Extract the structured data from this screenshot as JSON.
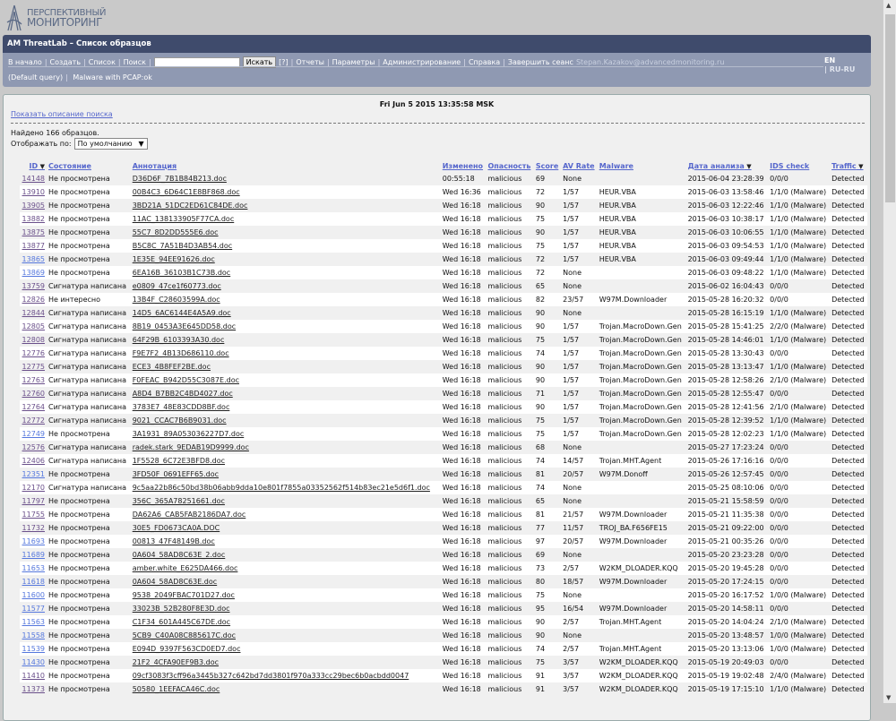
{
  "logo": {
    "line1": "ПЕРСПЕКТИВНЫЙ",
    "line2": "МОНИТОРИНГ"
  },
  "header": {
    "title": "AM ThreatLab – Список образцов"
  },
  "nav": {
    "items": [
      "В начало",
      "Создать",
      "Список",
      "Поиск"
    ],
    "search_value": "",
    "search_button": "Искать",
    "help": "[?]",
    "items2": [
      "Отчеты",
      "Параметры",
      "Администрирование",
      "Справка",
      "Завершить сеанс"
    ],
    "user": "Stepan.Kazakov@advancedmonitoring.ru",
    "queries": [
      "(Default query)",
      "Malware with PCAP:ok"
    ]
  },
  "lang": {
    "en": "EN",
    "ru": "| RU-RU"
  },
  "panel": {
    "datetime": "Fri Jun 5 2015 13:35:58 MSK",
    "show_desc": "Показать описание поиска",
    "found": "Найдено 166 образцов.",
    "display_label": "Отображать по:",
    "display_value": "По умолчанию"
  },
  "table": {
    "headers": [
      "ID",
      "Состояние",
      "Аннотация",
      "Изменено",
      "Опасность",
      "Score",
      "AV Rate",
      "Malware",
      "Дата анализа",
      "IDS check",
      "Traffic"
    ],
    "rows": [
      [
        "14148",
        "Не просмотрена",
        "D36D6F_7B1B84B213.doc",
        "00:55:18",
        "malicious",
        "69",
        "None",
        "",
        "2015-06-04 23:28:39",
        "0/0/0",
        "Detected"
      ],
      [
        "13910",
        "Не просмотрена",
        "00B4C3_6D64C1E8BF868.doc",
        "Wed 16:36",
        "malicious",
        "72",
        "1/57",
        "HEUR.VBA",
        "2015-06-03 13:58:46",
        "1/1/0 (Malware)",
        "Detected"
      ],
      [
        "13905",
        "Не просмотрена",
        "3BD21A_51DC2ED61C84DE.doc",
        "Wed 16:18",
        "malicious",
        "90",
        "1/57",
        "HEUR.VBA",
        "2015-06-03 12:22:46",
        "1/1/0 (Malware)",
        "Detected"
      ],
      [
        "13882",
        "Не просмотрена",
        "11AC_138133905F77CA.doc",
        "Wed 16:18",
        "malicious",
        "75",
        "1/57",
        "HEUR.VBA",
        "2015-06-03 10:38:17",
        "1/1/0 (Malware)",
        "Detected"
      ],
      [
        "13875",
        "Не просмотрена",
        "55C7_8D2DD555E6.doc",
        "Wed 16:18",
        "malicious",
        "90",
        "1/57",
        "HEUR.VBA",
        "2015-06-03 10:06:55",
        "1/1/0 (Malware)",
        "Detected"
      ],
      [
        "13877",
        "Не просмотрена",
        "B5C8C_7A51B4D3AB54.doc",
        "Wed 16:18",
        "malicious",
        "75",
        "1/57",
        "HEUR.VBA",
        "2015-06-03 09:54:53",
        "1/1/0 (Malware)",
        "Detected"
      ],
      [
        "13865",
        "Не просмотрена",
        "1E35E_94EE91626.doc",
        "Wed 16:18",
        "malicious",
        "72",
        "1/57",
        "HEUR.VBA",
        "2015-06-03 09:49:44",
        "1/1/0 (Malware)",
        "Detected"
      ],
      [
        "13869",
        "Не просмотрена",
        "6EA16B_36103B1C73B.doc",
        "Wed 16:18",
        "malicious",
        "72",
        "None",
        "",
        "2015-06-03 09:48:22",
        "1/1/0 (Malware)",
        "Detected"
      ],
      [
        "13759",
        "Сигнатура написана",
        "e0809_47ce1f60773.doc",
        "Wed 16:18",
        "malicious",
        "65",
        "None",
        "",
        "2015-06-02 16:04:43",
        "0/0/0",
        "Detected"
      ],
      [
        "12826",
        "Не интересно",
        "13B4F_C28603599A.doc",
        "Wed 16:18",
        "malicious",
        "82",
        "23/57",
        "W97M.Downloader",
        "2015-05-28 16:20:32",
        "0/0/0",
        "Detected"
      ],
      [
        "12844",
        "Сигнатура написана",
        "14D5_6AC6144E4A5A9.doc",
        "Wed 16:18",
        "malicious",
        "90",
        "None",
        "",
        "2015-05-28 16:15:19",
        "1/1/0 (Malware)",
        "Detected"
      ],
      [
        "12805",
        "Сигнатура написана",
        "8B19_0453A3E645DD58.doc",
        "Wed 16:18",
        "malicious",
        "90",
        "1/57",
        "Trojan.MacroDown.Gen",
        "2015-05-28 15:41:25",
        "2/2/0 (Malware)",
        "Detected"
      ],
      [
        "12808",
        "Сигнатура написана",
        "64F29B_6103393A30.doc",
        "Wed 16:18",
        "malicious",
        "75",
        "1/57",
        "Trojan.MacroDown.Gen",
        "2015-05-28 14:46:01",
        "1/1/0 (Malware)",
        "Detected"
      ],
      [
        "12776",
        "Сигнатура написана",
        "F9E7F2_4B13D686110.doc",
        "Wed 16:18",
        "malicious",
        "74",
        "1/57",
        "Trojan.MacroDown.Gen",
        "2015-05-28 13:30:43",
        "0/0/0",
        "Detected"
      ],
      [
        "12775",
        "Сигнатура написана",
        "ECE3_4B8FEF2BE.doc",
        "Wed 16:18",
        "malicious",
        "90",
        "1/57",
        "Trojan.MacroDown.Gen",
        "2015-05-28 13:13:47",
        "1/1/0 (Malware)",
        "Detected"
      ],
      [
        "12763",
        "Сигнатура написана",
        "F0FEAC_B942D55C3087E.doc",
        "Wed 16:18",
        "malicious",
        "90",
        "1/57",
        "Trojan.MacroDown.Gen",
        "2015-05-28 12:58:26",
        "2/1/0 (Malware)",
        "Detected"
      ],
      [
        "12760",
        "Сигнатура написана",
        "A8D4_B7BB2C4BD4027.doc",
        "Wed 16:18",
        "malicious",
        "71",
        "1/57",
        "Trojan.MacroDown.Gen",
        "2015-05-28 12:55:47",
        "0/0/0",
        "Detected"
      ],
      [
        "12764",
        "Сигнатура написана",
        "3783E7_48E83CDD8BF.doc",
        "Wed 16:18",
        "malicious",
        "90",
        "1/57",
        "Trojan.MacroDown.Gen",
        "2015-05-28 12:41:56",
        "2/1/0 (Malware)",
        "Detected"
      ],
      [
        "12772",
        "Сигнатура написана",
        "9021_CCAC7B6B9031.doc",
        "Wed 16:18",
        "malicious",
        "75",
        "1/57",
        "Trojan.MacroDown.Gen",
        "2015-05-28 12:39:52",
        "1/1/0 (Malware)",
        "Detected"
      ],
      [
        "12749",
        "Не просмотрена",
        "3A1931_89A053036227D7.doc",
        "Wed 16:18",
        "malicious",
        "75",
        "1/57",
        "Trojan.MacroDown.Gen",
        "2015-05-28 12:02:23",
        "1/1/0 (Malware)",
        "Detected"
      ],
      [
        "12576",
        "Сигнатура написана",
        "radek.stark_9EDAB19D9999.doc",
        "Wed 16:18",
        "malicious",
        "68",
        "None",
        "",
        "2015-05-27 17:23:24",
        "0/0/0",
        "Detected"
      ],
      [
        "12406",
        "Сигнатура написана",
        "1F5528_6C72E3BFD8.doc",
        "Wed 16:18",
        "malicious",
        "74",
        "14/57",
        "Trojan.MHT.Agent",
        "2015-05-26 17:16:16",
        "0/0/0",
        "Detected"
      ],
      [
        "12351",
        "Не просмотрена",
        "3FD50F_0691EFF65.doc",
        "Wed 16:18",
        "malicious",
        "81",
        "20/57",
        "W97M.Donoff",
        "2015-05-26 12:57:45",
        "0/0/0",
        "Detected"
      ],
      [
        "12170",
        "Сигнатура написана",
        "9c5aa22b86c50bd38b06abb9dda10e801f7855a03352562f514b83ec21e5d6f1.doc",
        "Wed 16:18",
        "malicious",
        "74",
        "None",
        "",
        "2015-05-25 08:10:06",
        "0/0/0",
        "Detected"
      ],
      [
        "11797",
        "Не просмотрена",
        "356C_365A78251661.doc",
        "Wed 16:18",
        "malicious",
        "65",
        "None",
        "",
        "2015-05-21 15:58:59",
        "0/0/0",
        "Detected"
      ],
      [
        "11755",
        "Не просмотрена",
        "DA62A6_CAB5FAB2186DA7.doc",
        "Wed 16:18",
        "malicious",
        "81",
        "21/57",
        "W97M.Downloader",
        "2015-05-21 11:35:38",
        "0/0/0",
        "Detected"
      ],
      [
        "11732",
        "Не просмотрена",
        "30E5_FD0673CA0A.DOC",
        "Wed 16:18",
        "malicious",
        "77",
        "11/57",
        "TROJ_BA.F656FE15",
        "2015-05-21 09:22:00",
        "0/0/0",
        "Detected"
      ],
      [
        "11693",
        "Не просмотрена",
        "00813_47F48149B.doc",
        "Wed 16:18",
        "malicious",
        "97",
        "20/57",
        "W97M.Downloader",
        "2015-05-21 00:35:26",
        "0/0/0",
        "Detected"
      ],
      [
        "11689",
        "Не просмотрена",
        "0A604_58AD8C63E_2.doc",
        "Wed 16:18",
        "malicious",
        "69",
        "None",
        "",
        "2015-05-20 23:23:28",
        "0/0/0",
        "Detected"
      ],
      [
        "11653",
        "Не просмотрена",
        "amber.white_E625DA466.doc",
        "Wed 16:18",
        "malicious",
        "73",
        "2/57",
        "W2KM_DLOADER.KQQ",
        "2015-05-20 19:45:28",
        "0/0/0",
        "Detected"
      ],
      [
        "11618",
        "Не просмотрена",
        "0A604_58AD8C63E.doc",
        "Wed 16:18",
        "malicious",
        "80",
        "18/57",
        "W97M.Downloader",
        "2015-05-20 17:24:15",
        "0/0/0",
        "Detected"
      ],
      [
        "11600",
        "Не просмотрена",
        "9538_2049FBAC701D27.doc",
        "Wed 16:18",
        "malicious",
        "75",
        "None",
        "",
        "2015-05-20 16:17:52",
        "1/0/0 (Malware)",
        "Detected"
      ],
      [
        "11577",
        "Не просмотрена",
        "33023B_52B280F8E3D.doc",
        "Wed 16:18",
        "malicious",
        "95",
        "16/54",
        "W97M.Downloader",
        "2015-05-20 14:58:11",
        "0/0/0",
        "Detected"
      ],
      [
        "11563",
        "Не просмотрена",
        "C1F34_601A445C67DE.doc",
        "Wed 16:18",
        "malicious",
        "90",
        "2/57",
        "Trojan.MHT.Agent",
        "2015-05-20 14:04:24",
        "2/1/0 (Malware)",
        "Detected"
      ],
      [
        "11558",
        "Не просмотрена",
        "5CB9_C40A08C885617C.doc",
        "Wed 16:18",
        "malicious",
        "90",
        "None",
        "",
        "2015-05-20 13:48:57",
        "1/0/0 (Malware)",
        "Detected"
      ],
      [
        "11539",
        "Не просмотрена",
        "E094D_9397F563CD0ED7.doc",
        "Wed 16:18",
        "malicious",
        "74",
        "2/57",
        "Trojan.MHT.Agent",
        "2015-05-20 13:13:06",
        "1/0/0 (Malware)",
        "Detected"
      ],
      [
        "11430",
        "Не просмотрена",
        "21F2_4CFA90EF9B3.doc",
        "Wed 16:18",
        "malicious",
        "75",
        "3/57",
        "W2KM_DLOADER.KQQ",
        "2015-05-19 20:49:03",
        "0/0/0",
        "Detected"
      ],
      [
        "11410",
        "Не просмотрена",
        "09cf3083f3cff96a3445b327c642bd7dd3801f970a333cc29bec6b0acbdd0047",
        "Wed 16:18",
        "malicious",
        "91",
        "3/57",
        "W2KM_DLOADER.KQQ",
        "2015-05-19 19:02:48",
        "2/4/0 (Malware)",
        "Detected"
      ],
      [
        "11373",
        "Не просмотрена",
        "50580_1EEFACA46C.doc",
        "Wed 16:18",
        "malicious",
        "91",
        "3/57",
        "W2KM_DLOADER.KQQ",
        "2015-05-19 17:15:10",
        "1/1/0 (Malware)",
        "Detected"
      ]
    ]
  }
}
